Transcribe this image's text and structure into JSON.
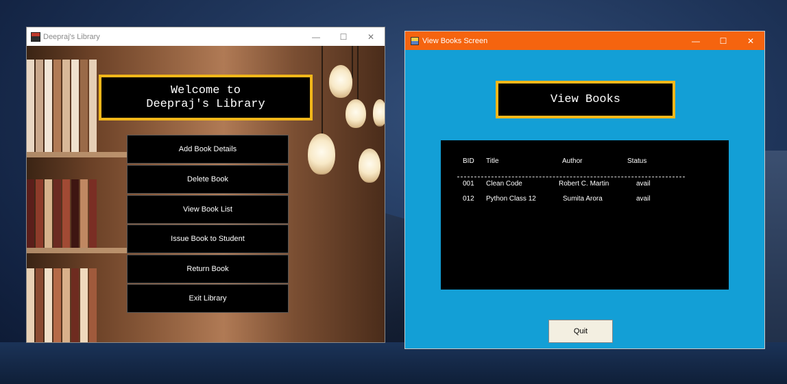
{
  "window1": {
    "title": "Deepraj's Library",
    "welcome_line1": "Welcome to",
    "welcome_line2": "Deepraj's Library",
    "buttons": [
      {
        "label": "Add Book Details"
      },
      {
        "label": "Delete Book"
      },
      {
        "label": "View Book List"
      },
      {
        "label": "Issue Book to Student"
      },
      {
        "label": "Return Book"
      },
      {
        "label": "Exit Library"
      }
    ]
  },
  "window2": {
    "title": "View Books Screen",
    "heading": "View Books",
    "table": {
      "headers": [
        "BID",
        "Title",
        "Author",
        "Status"
      ],
      "rows": [
        [
          "001",
          "Clean Code",
          "Robert C. Martin",
          "avail"
        ],
        [
          "012",
          "Python Class 12",
          "Sumita Arora",
          "avail"
        ]
      ]
    },
    "quit_label": "Quit"
  },
  "caption": {
    "minimize": "—",
    "maximize": "☐",
    "close": "✕"
  },
  "colors": {
    "accent_border": "#f2b71a",
    "win2_titlebar": "#f5640f",
    "win2_background": "#139fd6"
  }
}
